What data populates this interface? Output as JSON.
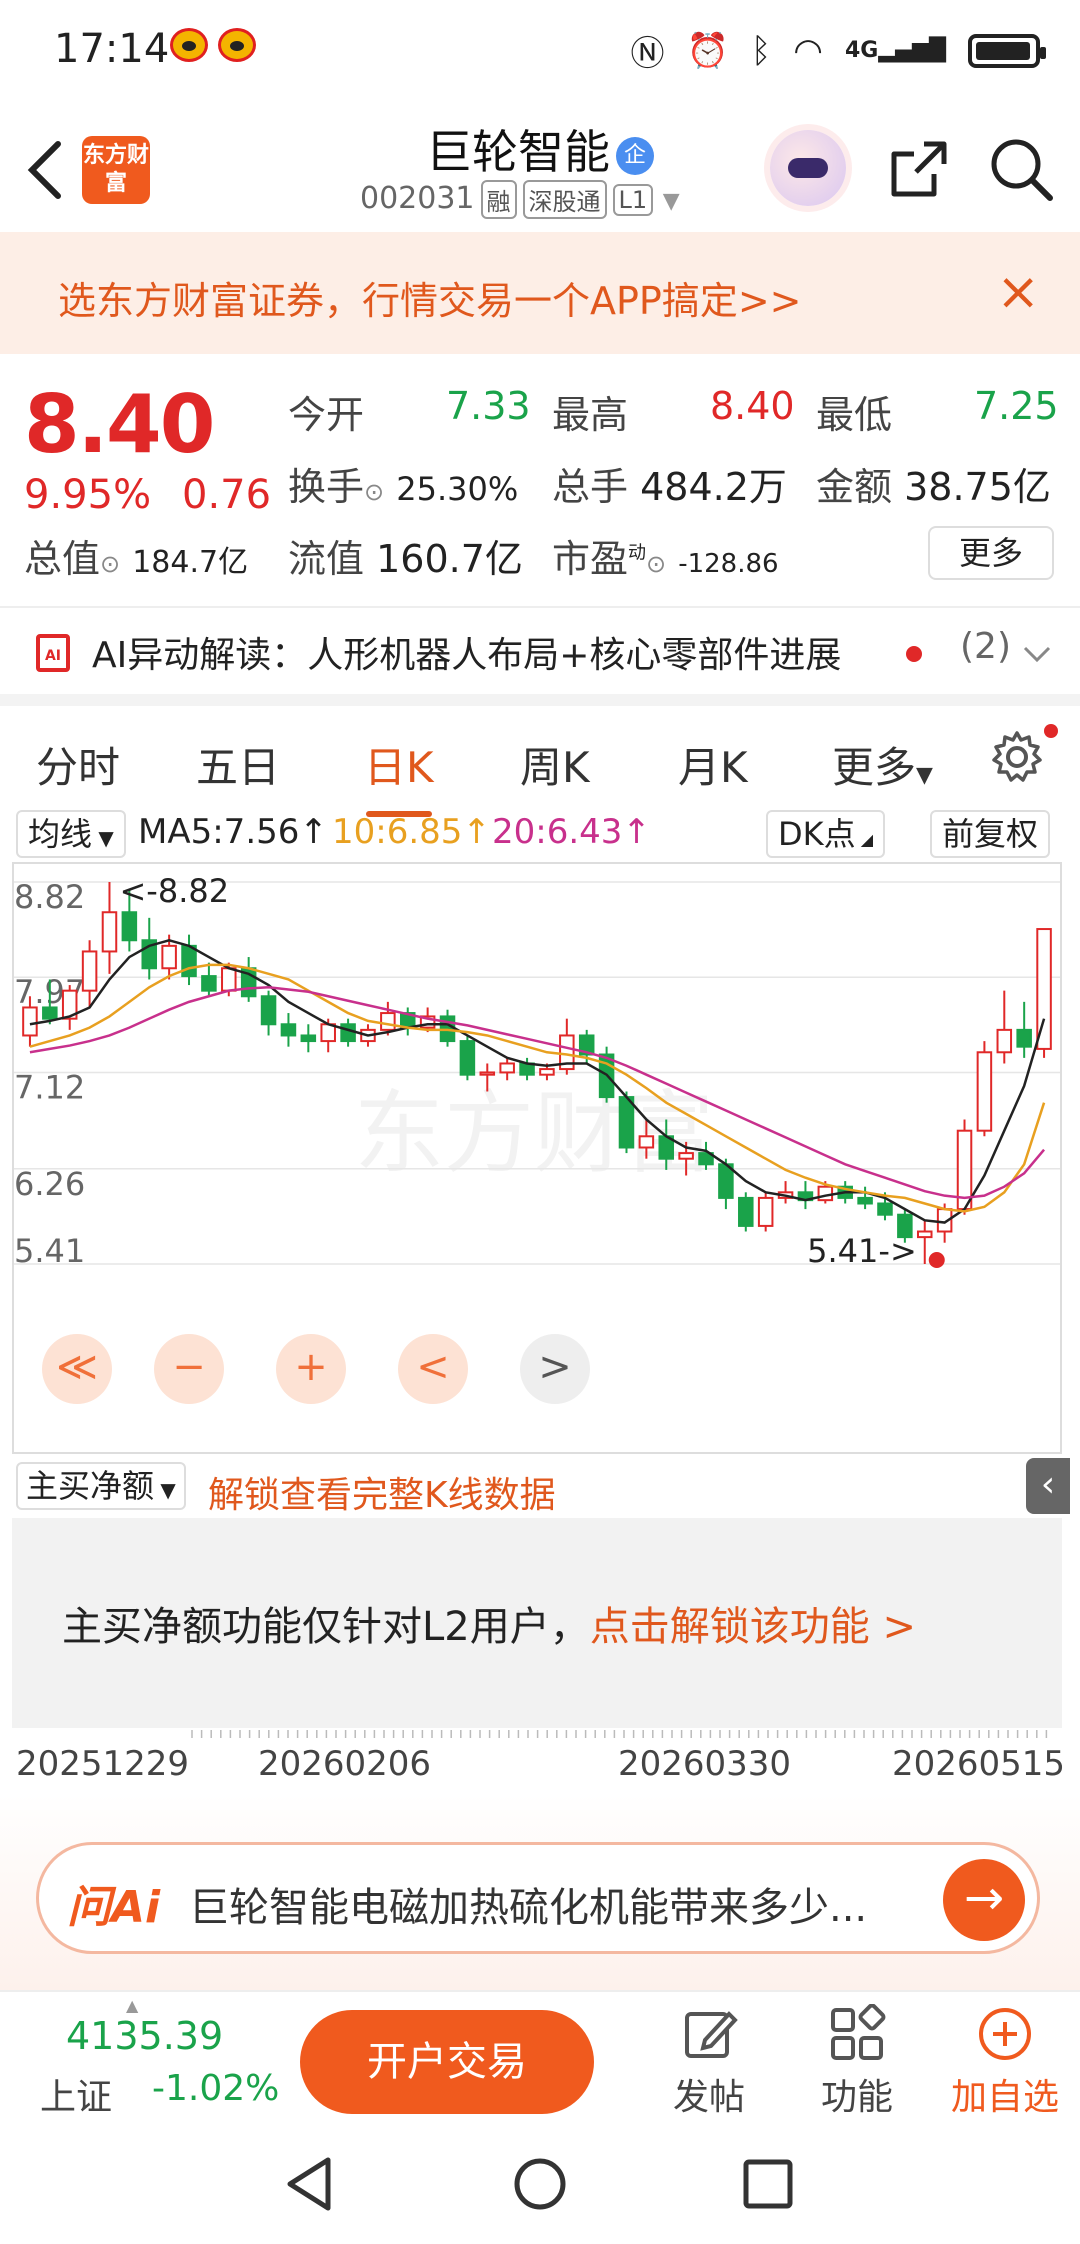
{
  "status_bar": {
    "time": "17:14",
    "network": "4G"
  },
  "header": {
    "stock_name": "巨轮智能",
    "badge": "企",
    "code": "002031",
    "tags": [
      "融",
      "深股通",
      "L1"
    ],
    "logo_text": "东方财富"
  },
  "banner": {
    "text": "选东方财富证券，行情交易一个APP搞定>>",
    "close": "×"
  },
  "quote": {
    "price": "8.40",
    "change_pct": "9.95%",
    "change": "0.76",
    "open_label": "今开",
    "open": "7.33",
    "high_label": "最高",
    "high": "8.40",
    "low_label": "最低",
    "low": "7.25",
    "turnover_label": "换手",
    "turnover": "25.30%",
    "volume_label": "总手",
    "volume": "484.2万",
    "amount_label": "金额",
    "amount": "38.75亿",
    "mktcap_label": "总值",
    "mktcap": "184.7亿",
    "float_label": "流值",
    "float_cap": "160.7亿",
    "pe_label": "市盈",
    "pe_sup": "动",
    "pe": "-128.86",
    "more_label": "更多"
  },
  "ai_bar": {
    "text": "AI异动解读：人形机器人布局+核心零部件进展",
    "count": "(2)",
    "icon": "AI"
  },
  "tabs": [
    "分时",
    "五日",
    "日K",
    "周K",
    "月K",
    "更多"
  ],
  "active_tab": "日K",
  "ma_bar": {
    "selector": "均线",
    "ma5": "MA5:7.56↑",
    "ma10": "10:6.85↑",
    "ma20": "20:6.43↑",
    "dk_label": "DK点",
    "fq_label": "前复权",
    "colors": {
      "ma5": "#222222",
      "ma10": "#e8a020",
      "ma20": "#c8308c"
    }
  },
  "chart_data": {
    "type": "candlestick",
    "y_ticks": [
      "8.82",
      "7.97",
      "7.12",
      "6.26",
      "5.41"
    ],
    "ylim": [
      5.41,
      8.82
    ],
    "max_label": "<-8.82",
    "min_label": "5.41->",
    "watermark": "东方财富",
    "x_tick_labels": [
      "20251229",
      "20260206",
      "20260330",
      "20260515"
    ],
    "up_color": "#e02828",
    "down_color": "#1aa34a",
    "candles": [
      {
        "o": 7.45,
        "h": 7.8,
        "l": 7.35,
        "c": 7.7
      },
      {
        "o": 7.7,
        "h": 7.95,
        "l": 7.55,
        "c": 7.6
      },
      {
        "o": 7.6,
        "h": 7.9,
        "l": 7.5,
        "c": 7.85
      },
      {
        "o": 7.85,
        "h": 8.3,
        "l": 7.7,
        "c": 8.2
      },
      {
        "o": 8.2,
        "h": 8.82,
        "l": 8.0,
        "c": 8.55
      },
      {
        "o": 8.55,
        "h": 8.75,
        "l": 8.2,
        "c": 8.3
      },
      {
        "o": 8.3,
        "h": 8.5,
        "l": 7.95,
        "c": 8.05
      },
      {
        "o": 8.05,
        "h": 8.35,
        "l": 7.95,
        "c": 8.25
      },
      {
        "o": 8.25,
        "h": 8.35,
        "l": 7.9,
        "c": 7.98
      },
      {
        "o": 7.98,
        "h": 8.1,
        "l": 7.8,
        "c": 7.85
      },
      {
        "o": 7.85,
        "h": 8.1,
        "l": 7.8,
        "c": 8.05
      },
      {
        "o": 8.05,
        "h": 8.15,
        "l": 7.75,
        "c": 7.8
      },
      {
        "o": 7.8,
        "h": 7.85,
        "l": 7.45,
        "c": 7.55
      },
      {
        "o": 7.55,
        "h": 7.65,
        "l": 7.35,
        "c": 7.45
      },
      {
        "o": 7.45,
        "h": 7.55,
        "l": 7.3,
        "c": 7.4
      },
      {
        "o": 7.4,
        "h": 7.6,
        "l": 7.3,
        "c": 7.55
      },
      {
        "o": 7.55,
        "h": 7.6,
        "l": 7.35,
        "c": 7.4
      },
      {
        "o": 7.4,
        "h": 7.55,
        "l": 7.35,
        "c": 7.5
      },
      {
        "o": 7.5,
        "h": 7.75,
        "l": 7.45,
        "c": 7.65
      },
      {
        "o": 7.65,
        "h": 7.7,
        "l": 7.45,
        "c": 7.52
      },
      {
        "o": 7.52,
        "h": 7.7,
        "l": 7.48,
        "c": 7.62
      },
      {
        "o": 7.62,
        "h": 7.68,
        "l": 7.35,
        "c": 7.4
      },
      {
        "o": 7.4,
        "h": 7.45,
        "l": 7.05,
        "c": 7.1
      },
      {
        "o": 7.1,
        "h": 7.2,
        "l": 6.95,
        "c": 7.12
      },
      {
        "o": 7.12,
        "h": 7.25,
        "l": 7.05,
        "c": 7.2
      },
      {
        "o": 7.2,
        "h": 7.25,
        "l": 7.05,
        "c": 7.1
      },
      {
        "o": 7.1,
        "h": 7.2,
        "l": 7.05,
        "c": 7.15
      },
      {
        "o": 7.15,
        "h": 7.6,
        "l": 7.1,
        "c": 7.45
      },
      {
        "o": 7.45,
        "h": 7.5,
        "l": 7.2,
        "c": 7.28
      },
      {
        "o": 7.28,
        "h": 7.35,
        "l": 6.85,
        "c": 6.9
      },
      {
        "o": 6.9,
        "h": 6.95,
        "l": 6.4,
        "c": 6.45
      },
      {
        "o": 6.45,
        "h": 6.7,
        "l": 6.35,
        "c": 6.55
      },
      {
        "o": 6.55,
        "h": 6.7,
        "l": 6.25,
        "c": 6.35
      },
      {
        "o": 6.35,
        "h": 6.5,
        "l": 6.2,
        "c": 6.4
      },
      {
        "o": 6.4,
        "h": 6.5,
        "l": 6.25,
        "c": 6.3
      },
      {
        "o": 6.3,
        "h": 6.35,
        "l": 5.9,
        "c": 6.0
      },
      {
        "o": 6.0,
        "h": 6.05,
        "l": 5.7,
        "c": 5.75
      },
      {
        "o": 5.75,
        "h": 6.05,
        "l": 5.7,
        "c": 6.0
      },
      {
        "o": 6.0,
        "h": 6.15,
        "l": 5.95,
        "c": 6.05
      },
      {
        "o": 6.05,
        "h": 6.15,
        "l": 5.9,
        "c": 5.98
      },
      {
        "o": 5.98,
        "h": 6.15,
        "l": 5.95,
        "c": 6.1
      },
      {
        "o": 6.1,
        "h": 6.15,
        "l": 5.95,
        "c": 6.0
      },
      {
        "o": 6.0,
        "h": 6.1,
        "l": 5.9,
        "c": 5.95
      },
      {
        "o": 5.95,
        "h": 6.05,
        "l": 5.8,
        "c": 5.85
      },
      {
        "o": 5.85,
        "h": 5.9,
        "l": 5.6,
        "c": 5.65
      },
      {
        "o": 5.65,
        "h": 5.8,
        "l": 5.41,
        "c": 5.7
      },
      {
        "o": 5.7,
        "h": 5.95,
        "l": 5.6,
        "c": 5.9
      },
      {
        "o": 5.9,
        "h": 6.7,
        "l": 5.85,
        "c": 6.6
      },
      {
        "o": 6.6,
        "h": 7.4,
        "l": 6.55,
        "c": 7.3
      },
      {
        "o": 7.3,
        "h": 7.85,
        "l": 7.2,
        "c": 7.5
      },
      {
        "o": 7.5,
        "h": 7.75,
        "l": 7.25,
        "c": 7.35
      },
      {
        "o": 7.33,
        "h": 8.4,
        "l": 7.25,
        "c": 8.4
      }
    ],
    "ma5": [
      7.55,
      7.58,
      7.62,
      7.7,
      7.95,
      8.15,
      8.25,
      8.3,
      8.25,
      8.15,
      8.05,
      8.0,
      7.9,
      7.75,
      7.65,
      7.55,
      7.5,
      7.45,
      7.48,
      7.52,
      7.55,
      7.55,
      7.45,
      7.35,
      7.25,
      7.2,
      7.18,
      7.2,
      7.2,
      7.1,
      6.9,
      6.7,
      6.55,
      6.45,
      6.42,
      6.3,
      6.15,
      6.05,
      6.02,
      5.98,
      6.02,
      6.05,
      6.05,
      6.0,
      5.9,
      5.8,
      5.78,
      5.9,
      6.2,
      6.6,
      7.0,
      7.6
    ],
    "ma10": [
      7.35,
      7.4,
      7.45,
      7.52,
      7.62,
      7.75,
      7.88,
      7.98,
      8.05,
      8.08,
      8.08,
      8.05,
      8.0,
      7.95,
      7.85,
      7.75,
      7.65,
      7.58,
      7.55,
      7.52,
      7.5,
      7.5,
      7.48,
      7.45,
      7.4,
      7.35,
      7.3,
      7.28,
      7.25,
      7.2,
      7.1,
      6.98,
      6.85,
      6.75,
      6.65,
      6.55,
      6.45,
      6.35,
      6.25,
      6.18,
      6.12,
      6.08,
      6.05,
      6.02,
      6.0,
      5.95,
      5.9,
      5.88,
      5.92,
      6.05,
      6.3,
      6.85
    ],
    "ma20": [
      7.3,
      7.33,
      7.36,
      7.4,
      7.45,
      7.52,
      7.6,
      7.68,
      7.75,
      7.8,
      7.85,
      7.87,
      7.88,
      7.86,
      7.84,
      7.8,
      7.76,
      7.72,
      7.68,
      7.64,
      7.6,
      7.57,
      7.54,
      7.5,
      7.46,
      7.42,
      7.38,
      7.34,
      7.3,
      7.25,
      7.18,
      7.1,
      7.02,
      6.94,
      6.86,
      6.78,
      6.7,
      6.62,
      6.54,
      6.46,
      6.38,
      6.3,
      6.24,
      6.18,
      6.12,
      6.06,
      6.02,
      6.0,
      6.02,
      6.1,
      6.22,
      6.43
    ]
  },
  "chart_controls": [
    "≪",
    "−",
    "+",
    "<",
    ">"
  ],
  "sub_panel": {
    "selector": "主买净额",
    "unlock_link": "解锁查看完整K线数据"
  },
  "lock_panel": {
    "text": "主买净额功能仅针对L2用户，",
    "link": "点击解锁该功能 >"
  },
  "ask_ai": {
    "logo": "问Ai",
    "text": "巨轮智能电磁加热硫化机能带来多少..."
  },
  "bottom_bar": {
    "index_value": "4135.39",
    "index_name": "上证",
    "index_change": "-1.02%",
    "trade_button": "开户交易",
    "post_label": "发帖",
    "func_label": "功能",
    "watch_label": "加自选"
  }
}
